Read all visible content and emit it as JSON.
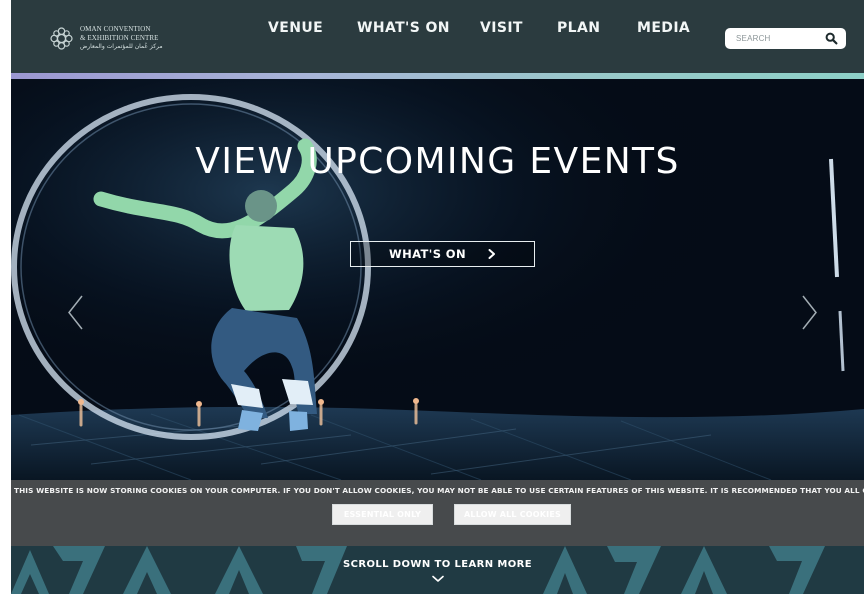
{
  "header": {
    "logo": {
      "line1": "OMAN CONVENTION",
      "line2": "& EXHIBITION CENTRE",
      "line3": "مركز عُمان للمؤتمرات والمعارض",
      "icon": "flower-logo-icon"
    },
    "nav": [
      {
        "label": "VENUE"
      },
      {
        "label": "WHAT'S ON"
      },
      {
        "label": "VISIT"
      },
      {
        "label": "PLAN"
      },
      {
        "label": "MEDIA"
      }
    ],
    "search": {
      "placeholder": "SEARCH",
      "value": "",
      "icon": "search-icon"
    }
  },
  "hero": {
    "title": "VIEW UPCOMING EVENTS",
    "button_label": "WHAT'S ON",
    "button_icon": "chevron-right-icon",
    "prev_icon": "chevron-left-icon",
    "next_icon": "chevron-right-icon"
  },
  "cookie_banner": {
    "text": "THIS WEBSITE IS NOW STORING COOKIES ON YOUR COMPUTER. IF YOU DON'T ALLOW COOKIES, YOU MAY NOT BE ABLE TO USE CERTAIN FEATURES OF THIS WEBSITE. IT IS RECOMMENDED THAT YOU ALL COOKIES",
    "essential_label": "ESSENTIAL ONLY",
    "allow_label": "ALLOW ALL COOKIES"
  },
  "footer_prompt": {
    "label": "SCROLL DOWN TO LEARN MORE",
    "icon": "chevron-down-icon"
  },
  "colors": {
    "header_bg": "#2b3b3f",
    "accent_start": "#9c97d2",
    "accent_end": "#8dd0c8",
    "cookie_bg": "#474a4c",
    "pattern_bg": "#203a43"
  }
}
